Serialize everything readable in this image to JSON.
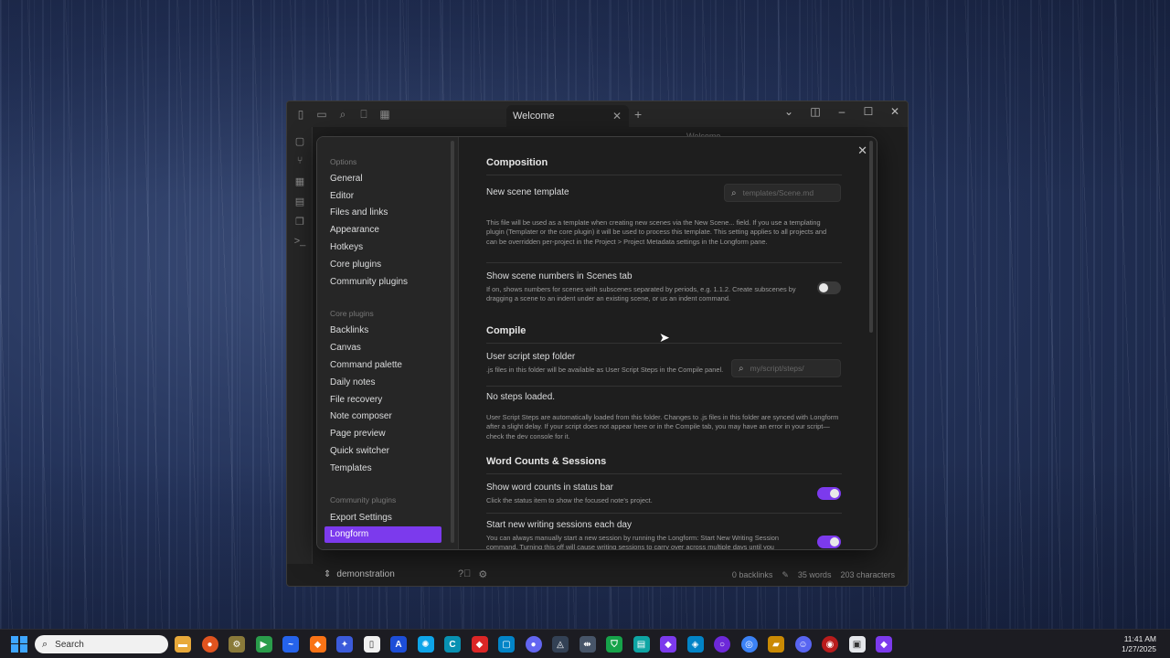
{
  "window": {
    "tab_title": "Welcome",
    "bg_note_title": "Welcome",
    "vault_name": "demonstration",
    "status": {
      "backlinks": "0 backlinks",
      "words": "35 words",
      "characters": "203 characters"
    }
  },
  "settings": {
    "sidebar": {
      "options_header": "Options",
      "options": [
        "General",
        "Editor",
        "Files and links",
        "Appearance",
        "Hotkeys",
        "Core plugins",
        "Community plugins"
      ],
      "core_header": "Core plugins",
      "core": [
        "Backlinks",
        "Canvas",
        "Command palette",
        "Daily notes",
        "File recovery",
        "Note composer",
        "Page preview",
        "Quick switcher",
        "Templates"
      ],
      "community_header": "Community plugins",
      "community": [
        "Export Settings",
        "Longform"
      ],
      "active": "Longform"
    },
    "composition": {
      "heading": "Composition",
      "template_name": "New scene template",
      "template_placeholder": "templates/Scene.md",
      "template_desc": "This file will be used as a template when creating new scenes via the New Scene... field. If you use a templating plugin (Templater or the core plugin) it will be used to process this template. This setting applies to all projects and can be overridden per-project in the Project > Project Metadata settings in the Longform pane.",
      "scene_numbers_name": "Show scene numbers in Scenes tab",
      "scene_numbers_desc": "If on, shows numbers for scenes with subscenes separated by periods, e.g. 1.1.2. Create subscenes by dragging a scene to an indent under an existing scene, or us an indent command.",
      "scene_numbers_on": false
    },
    "compile": {
      "heading": "Compile",
      "folder_name": "User script step folder",
      "folder_desc": ".js files in this folder will be available as User Script Steps in the Compile panel.",
      "folder_placeholder": "my/script/steps/",
      "no_steps": "No steps loaded.",
      "steps_desc": "User Script Steps are automatically loaded from this folder. Changes to .js files in this folder are synced with Longform after a slight delay. If your script does not appear here or in the Compile tab, you may have an error in your script—check the dev console for it."
    },
    "word_counts": {
      "heading": "Word Counts & Sessions",
      "status_bar_name": "Show word counts in status bar",
      "status_bar_desc": "Click the status item to show the focused note's project.",
      "status_bar_on": true,
      "sessions_name": "Start new writing sessions each day",
      "sessions_desc": "You can always manually start a new session by running the Longform: Start New Writing Session command. Turning this off will cause writing sessions to carry over across multiple days until you",
      "sessions_on": true
    }
  },
  "taskbar": {
    "search_label": "Search",
    "time": "11:41 AM",
    "date": "1/27/2025"
  },
  "colors": {
    "accent": "#7c3aed",
    "panel": "#1e1e1e",
    "sidebar": "#262626"
  }
}
